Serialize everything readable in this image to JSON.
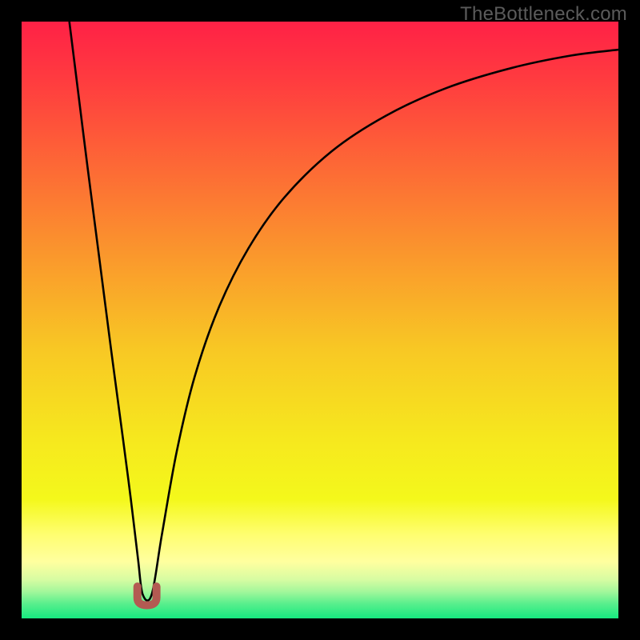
{
  "watermark": {
    "text": "TheBottleneck.com"
  },
  "chart_data": {
    "type": "line",
    "title": "",
    "xlabel": "",
    "ylabel": "",
    "xlim": [
      0,
      100
    ],
    "ylim": [
      0,
      100
    ],
    "background_gradient": {
      "stops": [
        {
          "pos": 0.0,
          "color": "#ff2146"
        },
        {
          "pos": 0.1,
          "color": "#ff3c3f"
        },
        {
          "pos": 0.25,
          "color": "#fd6b35"
        },
        {
          "pos": 0.4,
          "color": "#fa9a2c"
        },
        {
          "pos": 0.55,
          "color": "#f8c824"
        },
        {
          "pos": 0.7,
          "color": "#f6e81e"
        },
        {
          "pos": 0.8,
          "color": "#f4f81b"
        },
        {
          "pos": 0.86,
          "color": "#fffe71"
        },
        {
          "pos": 0.905,
          "color": "#ffff9f"
        },
        {
          "pos": 0.935,
          "color": "#d7fca2"
        },
        {
          "pos": 0.955,
          "color": "#a3f79b"
        },
        {
          "pos": 0.975,
          "color": "#5aef8d"
        },
        {
          "pos": 1.0,
          "color": "#16e97f"
        }
      ]
    },
    "series": [
      {
        "name": "bottleneck-curve",
        "type": "line",
        "stroke": "#000000",
        "width": 2.6,
        "points": [
          {
            "x": 8.0,
            "y": 100.0
          },
          {
            "x": 9.0,
            "y": 92.0
          },
          {
            "x": 11.0,
            "y": 76.0
          },
          {
            "x": 13.0,
            "y": 60.5
          },
          {
            "x": 15.0,
            "y": 45.0
          },
          {
            "x": 17.0,
            "y": 30.0
          },
          {
            "x": 18.3,
            "y": 20.0
          },
          {
            "x": 19.5,
            "y": 10.0
          },
          {
            "x": 20.3,
            "y": 4.0
          },
          {
            "x": 21.8,
            "y": 4.0
          },
          {
            "x": 23.5,
            "y": 14.0
          },
          {
            "x": 26.0,
            "y": 28.0
          },
          {
            "x": 29.0,
            "y": 40.5
          },
          {
            "x": 33.0,
            "y": 52.0
          },
          {
            "x": 38.0,
            "y": 62.0
          },
          {
            "x": 44.0,
            "y": 70.5
          },
          {
            "x": 52.0,
            "y": 78.3
          },
          {
            "x": 61.0,
            "y": 84.2
          },
          {
            "x": 71.0,
            "y": 88.8
          },
          {
            "x": 82.0,
            "y": 92.2
          },
          {
            "x": 92.0,
            "y": 94.3
          },
          {
            "x": 100.0,
            "y": 95.3
          }
        ]
      },
      {
        "name": "min-marker",
        "type": "marker",
        "shape": "u",
        "stroke": "#b35a52",
        "width": 10,
        "cx": 21.0,
        "cy": 3.5,
        "r": 1.6
      }
    ]
  }
}
